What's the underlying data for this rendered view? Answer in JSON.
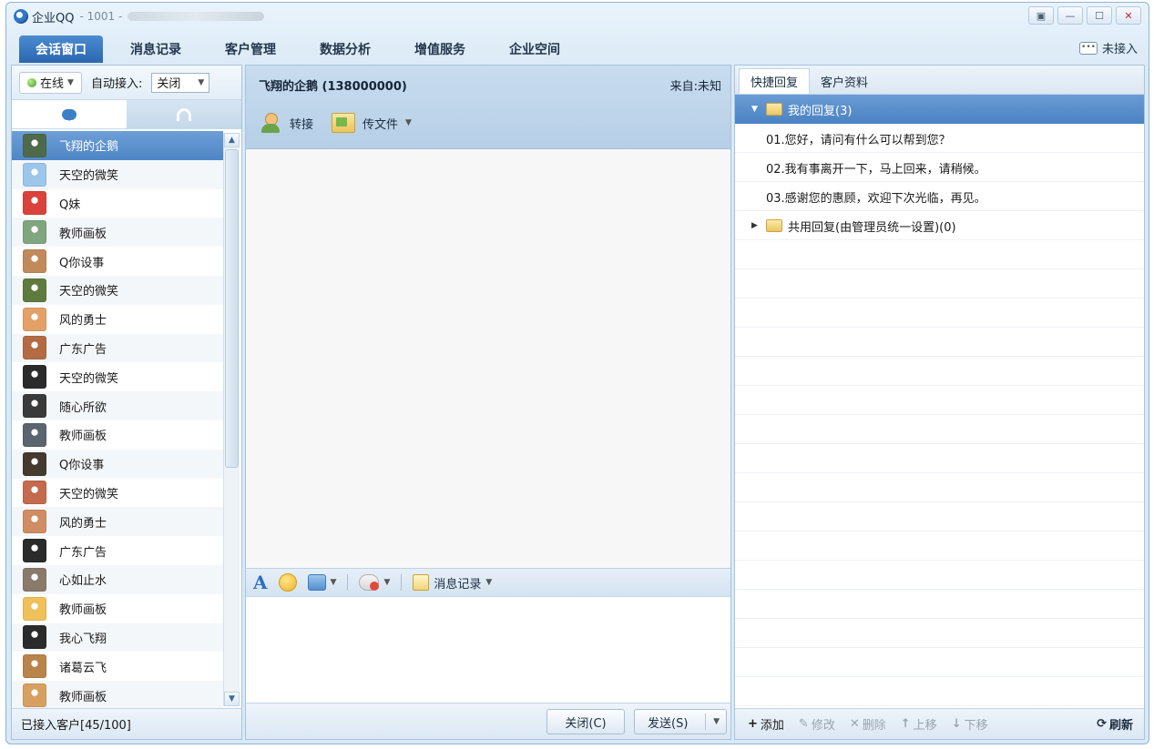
{
  "titlebar": {
    "app_name": "企业QQ",
    "account_id": "- 1001 -"
  },
  "nav": {
    "tabs": [
      "会话窗口",
      "消息记录",
      "客户管理",
      "数据分析",
      "增值服务",
      "企业空间"
    ],
    "not_accepted_label": "未接入",
    "chat_icon_text": "•••"
  },
  "left": {
    "status_label": "在线",
    "auto_accept_label": "自动接入:",
    "auto_accept_value": "关闭",
    "contacts": [
      "飞翔的企鹅",
      "天空的微笑",
      "Q妹",
      "教师画板",
      "Q你设事",
      "天空的微笑",
      "风的勇士",
      "广东广告",
      "天空的微笑",
      "随心所欲",
      "教师画板",
      "Q你设事",
      "天空的微笑",
      "风的勇士",
      "广东广告",
      "心如止水",
      "教师画板",
      "我心飞翔",
      "诸葛云飞",
      "教师画板"
    ],
    "avatar_colors": [
      "#4e6a4a",
      "#9cc6ea",
      "#d9433c",
      "#7fa67e",
      "#c08a5a",
      "#5f7a3e",
      "#e3a168",
      "#b26b43",
      "#2b2b2b",
      "#3a3a3a",
      "#5a6570",
      "#443a30",
      "#c46a4e",
      "#d08d63",
      "#2b2b2b",
      "#8a7a6a",
      "#f0c05a",
      "#2b2b2b",
      "#b8844a",
      "#d8a060"
    ],
    "footer_text": "已接入客户[45/100]"
  },
  "center": {
    "customer_name": "飞翔的企鹅 (138000000)",
    "source_label": "来自:未知",
    "transfer_label": "转接",
    "send_file_label": "传文件",
    "history_label": "消息记录",
    "close_button": "关闭(C)",
    "send_button": "发送(S)"
  },
  "right": {
    "tabs": [
      "快捷回复",
      "客户资料"
    ],
    "my_replies_folder": "我的回复(3)",
    "replies": [
      "01.您好，请问有什么可以帮到您？",
      "02.我有事离开一下，马上回来，请稍候。",
      "03.感谢您的惠顾，欢迎下次光临，再见。"
    ],
    "shared_folder": "共用回复(由管理员统一设置)(0)",
    "footer": {
      "add": "添加",
      "edit": "修改",
      "delete": "删除",
      "up": "上移",
      "down": "下移",
      "refresh": "刷新"
    }
  }
}
